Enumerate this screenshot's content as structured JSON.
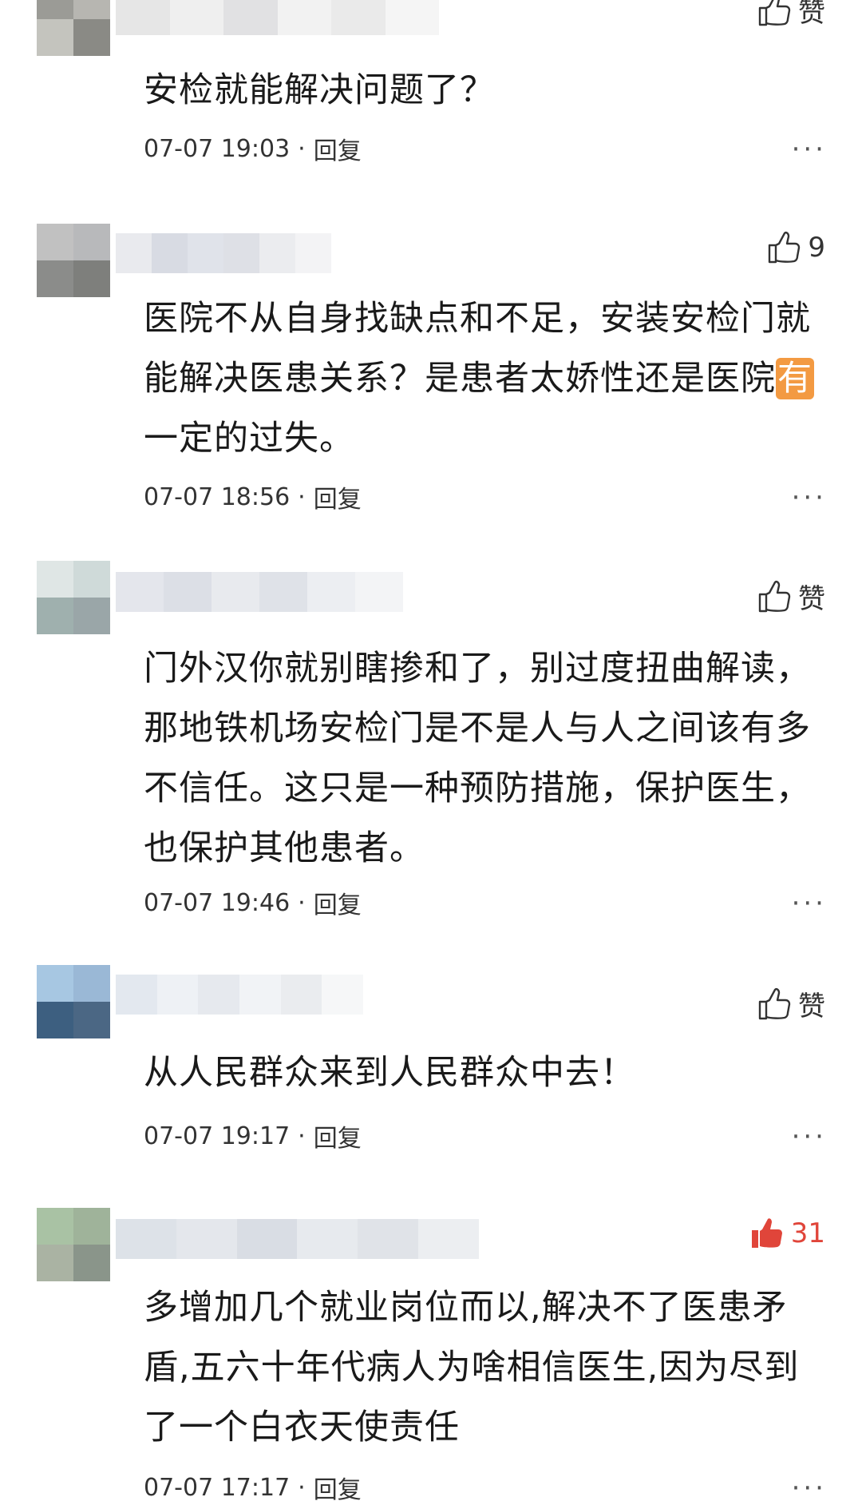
{
  "colors": {
    "accent_like": "#e0453a",
    "text": "#1a1a1a",
    "meta": "#333333",
    "highlight": "#f39a42"
  },
  "comments": [
    {
      "avatar_colors": [
        "#9b9b96",
        "#b7b6b1",
        "#c4c4be",
        "#8a8a85"
      ],
      "username_colors": [
        "#e6e6e6",
        "#efefef",
        "#e1e1e3",
        "#f2f2f2",
        "#eaeaea",
        "#f5f5f5"
      ],
      "likes": "赞",
      "liked": false,
      "text": "安检就能解决问题了？",
      "date": "07-07 19:03",
      "reply": "回复",
      "more_icon": "ellipsis-icon",
      "more": "···"
    },
    {
      "avatar_colors": [
        "#c1c1c1",
        "#b8b9bb",
        "#8b8c8a",
        "#7e7f7c"
      ],
      "username_colors": [
        "#e9eaee",
        "#d8dbe3",
        "#e0e3ea",
        "#dee0e6",
        "#ebecef",
        "#f3f3f5"
      ],
      "likes": "9",
      "liked": false,
      "text_before": "医院不从自身找缺点和不足，安装安检门就能解决医患关系？是患者太娇性还是医院",
      "text_highlight": "有",
      "text_after": "一定的过失。",
      "date": "07-07 18:56",
      "reply": "回复",
      "more_icon": "ellipsis-icon",
      "more": "···"
    },
    {
      "avatar_colors": [
        "#dfe6e5",
        "#cfdad9",
        "#9fb0ae",
        "#9aa6a8"
      ],
      "username_colors": [
        "#e4e6ec",
        "#dcdfe6",
        "#e8eaee",
        "#dfe2e8",
        "#eceef2",
        "#f3f4f6"
      ],
      "likes": "赞",
      "liked": false,
      "text": "门外汉你就别瞎掺和了，别过度扭曲解读，那地铁机场安检门是不是人与人之间该有多不信任。这只是一种预防措施，保护医生，也保护其他患者。",
      "date": "07-07 19:46",
      "reply": "回复",
      "more_icon": "ellipsis-icon",
      "more": "···"
    },
    {
      "avatar_colors": [
        "#a7c7e2",
        "#9ab8d6",
        "#3d5f80",
        "#4b6784"
      ],
      "username_colors": [
        "#e3e8ef",
        "#eef1f5",
        "#e6e9ee",
        "#f1f3f6",
        "#eaecef",
        "#f6f7f8"
      ],
      "likes": "赞",
      "liked": false,
      "text": "从人民群众来到人民群众中去！",
      "date": "07-07 19:17",
      "reply": "回复",
      "more_icon": "ellipsis-icon",
      "more": "···"
    },
    {
      "avatar_colors": [
        "#a9c2a4",
        "#9fb39a",
        "#aab3a3",
        "#8a958a"
      ],
      "username_colors": [
        "#dde2e8",
        "#e4e7ec",
        "#d9dde4",
        "#e7eaee",
        "#e0e3e8",
        "#eceef1"
      ],
      "likes": "31",
      "liked": true,
      "text": "多增加几个就业岗位而以,解决不了医患矛盾,五六十年代病人为啥相信医生,因为尽到了一个白衣天使责任",
      "date": "07-07 17:17",
      "reply": "回复",
      "more_icon": "ellipsis-icon",
      "more": "···"
    }
  ]
}
